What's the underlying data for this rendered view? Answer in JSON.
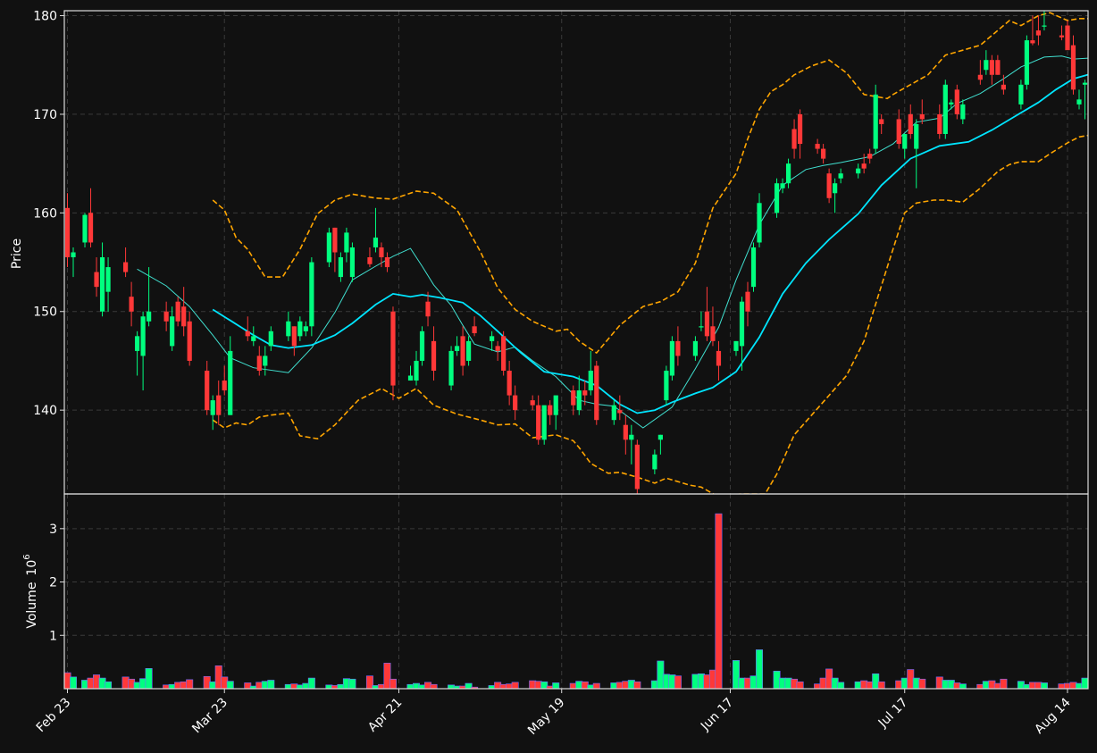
{
  "chart_data": {
    "type": "candlestick",
    "xlabel": "",
    "date_ticks": [
      "Feb 23",
      "Mar 23",
      "Apr 21",
      "May 19",
      "Jun 17",
      "Jul 17",
      "Aug 14"
    ],
    "tick_day_index": [
      0,
      27,
      57,
      85,
      114,
      144,
      172
    ],
    "price_panel": {
      "ylabel": "Price",
      "ylim": [
        131.5,
        180.5
      ],
      "yticks": [
        140,
        150,
        160,
        170,
        180
      ],
      "grid": true
    },
    "volume_panel": {
      "ylabel": "Volume",
      "exponent_label": "10",
      "exponent_power": "6",
      "ylim": [
        0,
        3.65
      ],
      "yticks": [
        1,
        2,
        3
      ],
      "grid": true
    },
    "colors": {
      "up": "#00ff7f",
      "down": "#ff3838",
      "ma_fast": "#40e0d0",
      "ma_slow": "#00e5ff",
      "bands": "#ffa500",
      "background": "#111111"
    },
    "series_style": {
      "ma_fast_width": 1,
      "ma_slow_width": 1.8,
      "band_dash": true
    },
    "days": [
      0,
      1,
      3,
      4,
      5,
      6,
      7,
      10,
      11,
      12,
      13,
      14,
      17,
      18,
      19,
      20,
      21,
      24,
      25,
      26,
      27,
      28,
      31,
      32,
      33,
      34,
      35,
      38,
      39,
      40,
      41,
      42,
      45,
      46,
      47,
      48,
      49,
      52,
      53,
      54,
      55,
      56,
      59,
      60,
      61,
      62,
      63,
      66,
      67,
      68,
      69,
      70,
      73,
      74,
      75,
      76,
      77,
      80,
      81,
      82,
      83,
      84,
      87,
      88,
      89,
      90,
      91,
      94,
      95,
      96,
      97,
      98,
      101,
      102,
      103,
      104,
      105,
      108,
      109,
      110,
      111,
      112,
      115,
      116,
      117,
      118,
      119,
      122,
      123,
      124,
      125,
      126,
      129,
      130,
      131,
      132,
      133,
      136,
      137,
      138,
      139,
      140,
      143,
      144,
      145,
      146,
      147,
      150,
      151,
      152,
      153,
      154,
      157,
      158,
      159,
      160,
      161,
      164,
      165,
      166,
      167,
      168,
      171,
      172,
      173,
      174,
      175
    ],
    "ohlc": [
      [
        160.5,
        162.0,
        154.5,
        155.5
      ],
      [
        155.5,
        156.5,
        153.5,
        156.0
      ],
      [
        157.0,
        160.0,
        156.5,
        159.8
      ],
      [
        160.0,
        162.5,
        156.5,
        157.0
      ],
      [
        154.0,
        155.5,
        151.5,
        152.5
      ],
      [
        150.0,
        157.0,
        149.5,
        155.5
      ],
      [
        152.0,
        155.5,
        150.0,
        154.5
      ],
      [
        155.0,
        156.5,
        153.5,
        154.0
      ],
      [
        151.5,
        153.0,
        148.5,
        150.0
      ],
      [
        146.0,
        148.0,
        143.5,
        147.5
      ],
      [
        145.5,
        150.0,
        142.0,
        149.5
      ],
      [
        149.0,
        154.5,
        148.5,
        150.0
      ],
      [
        150.0,
        151.0,
        148.0,
        149.0
      ],
      [
        146.5,
        150.5,
        146.0,
        149.5
      ],
      [
        151.0,
        151.5,
        148.5,
        149.0
      ],
      [
        150.5,
        152.5,
        147.5,
        148.5
      ],
      [
        149.0,
        150.0,
        144.5,
        145.0
      ],
      [
        144.0,
        145.0,
        139.5,
        140.0
      ],
      [
        139.5,
        141.5,
        138.0,
        141.0
      ],
      [
        141.5,
        143.0,
        138.5,
        139.5
      ],
      [
        143.0,
        144.5,
        141.5,
        142.0
      ],
      [
        139.5,
        147.5,
        139.5,
        146.0
      ],
      [
        148.0,
        149.5,
        147.0,
        147.5
      ],
      [
        147.0,
        148.5,
        146.5,
        147.5
      ],
      [
        145.5,
        146.5,
        143.5,
        144.0
      ],
      [
        144.5,
        146.5,
        143.5,
        145.5
      ],
      [
        146.5,
        148.5,
        146.0,
        148.0
      ],
      [
        147.5,
        150.0,
        147.0,
        149.0
      ],
      [
        148.5,
        148.5,
        145.5,
        146.5
      ],
      [
        147.5,
        149.5,
        147.0,
        149.0
      ],
      [
        148.0,
        149.0,
        147.5,
        148.5
      ],
      [
        148.5,
        155.5,
        147.5,
        155.0
      ],
      [
        155.0,
        158.5,
        154.5,
        158.0
      ],
      [
        158.5,
        158.5,
        154.0,
        156.0
      ],
      [
        153.5,
        156.0,
        153.0,
        155.5
      ],
      [
        156.0,
        158.5,
        155.0,
        158.0
      ],
      [
        153.5,
        157.0,
        153.0,
        156.5
      ],
      [
        155.5,
        156.5,
        154.5,
        154.8
      ],
      [
        156.5,
        160.5,
        156.0,
        157.5
      ],
      [
        156.5,
        157.0,
        154.5,
        155.5
      ],
      [
        155.5,
        156.0,
        154.0,
        154.5
      ],
      [
        150.0,
        150.5,
        141.0,
        142.5
      ],
      [
        143.0,
        144.5,
        143.0,
        143.5
      ],
      [
        143.0,
        146.0,
        142.5,
        145.0
      ],
      [
        145.0,
        148.5,
        144.5,
        148.0
      ],
      [
        151.0,
        152.0,
        148.5,
        149.5
      ],
      [
        147.0,
        148.5,
        143.0,
        144.0
      ],
      [
        142.5,
        146.5,
        142.0,
        146.0
      ],
      [
        146.0,
        147.5,
        145.5,
        146.5
      ],
      [
        147.5,
        148.5,
        143.5,
        144.5
      ],
      [
        145.0,
        147.5,
        144.5,
        147.0
      ],
      [
        148.5,
        149.5,
        147.5,
        147.8
      ],
      [
        147.0,
        148.0,
        146.0,
        147.5
      ],
      [
        146.5,
        147.0,
        145.0,
        146.0
      ],
      [
        147.5,
        148.0,
        143.5,
        144.0
      ],
      [
        144.0,
        145.0,
        140.5,
        141.5
      ],
      [
        141.5,
        142.5,
        139.0,
        140.0
      ],
      [
        141.0,
        141.5,
        140.0,
        140.5
      ],
      [
        140.5,
        141.5,
        136.5,
        137.0
      ],
      [
        137.0,
        140.0,
        136.5,
        140.5
      ],
      [
        140.5,
        141.0,
        138.5,
        139.5
      ],
      [
        139.5,
        140.5,
        138.0,
        141.5
      ],
      [
        142.0,
        142.5,
        139.5,
        140.5
      ],
      [
        140.0,
        143.5,
        139.5,
        142.0
      ],
      [
        142.0,
        143.0,
        140.5,
        141.5
      ],
      [
        142.0,
        146.0,
        141.5,
        144.0
      ],
      [
        144.5,
        145.0,
        138.5,
        139.0
      ],
      [
        139.0,
        141.0,
        138.5,
        140.5
      ],
      [
        140.0,
        141.5,
        139.0,
        139.7
      ],
      [
        138.5,
        139.5,
        135.5,
        137.0
      ],
      [
        137.0,
        138.5,
        134.5,
        137.5
      ],
      [
        136.5,
        137.0,
        131.0,
        132.0
      ],
      [
        134.0,
        136.0,
        133.5,
        135.5
      ],
      [
        137.0,
        137.5,
        135.5,
        137.5
      ],
      [
        141.0,
        144.5,
        140.5,
        144.0
      ],
      [
        143.5,
        147.5,
        143.0,
        147.0
      ],
      [
        147.0,
        148.5,
        144.5,
        145.5
      ],
      [
        145.5,
        147.5,
        145.0,
        147.0
      ],
      [
        148.5,
        150.0,
        148.0,
        148.5
      ],
      [
        150.0,
        152.5,
        147.0,
        147.5
      ],
      [
        148.5,
        150.5,
        146.5,
        147.0
      ],
      [
        146.0,
        147.0,
        143.0,
        144.5
      ],
      [
        146.0,
        147.0,
        145.5,
        147.0
      ],
      [
        146.5,
        151.5,
        144.0,
        151.0
      ],
      [
        152.0,
        153.0,
        148.5,
        150.0
      ],
      [
        152.5,
        157.0,
        152.0,
        156.5
      ],
      [
        157.0,
        162.0,
        156.5,
        161.0
      ],
      [
        160.0,
        163.5,
        159.5,
        163.0
      ],
      [
        162.5,
        163.5,
        162.0,
        163.0
      ],
      [
        163.0,
        165.5,
        162.5,
        165.0
      ],
      [
        168.5,
        169.5,
        165.5,
        166.5
      ],
      [
        170.0,
        170.5,
        165.5,
        167.0
      ],
      [
        167.0,
        167.5,
        166.0,
        166.5
      ],
      [
        166.5,
        167.0,
        165.0,
        165.5
      ],
      [
        164.0,
        164.5,
        161.0,
        161.5
      ],
      [
        162.0,
        163.5,
        160.0,
        163.0
      ],
      [
        163.5,
        164.5,
        163.0,
        164.0
      ],
      [
        164.0,
        165.0,
        163.5,
        164.5
      ],
      [
        165.0,
        166.0,
        164.0,
        164.5
      ],
      [
        166.0,
        166.5,
        165.0,
        165.5
      ],
      [
        166.5,
        173.0,
        166.0,
        172.0
      ],
      [
        169.5,
        170.0,
        168.0,
        169.0
      ],
      [
        169.5,
        170.5,
        166.5,
        167.0
      ],
      [
        166.5,
        168.0,
        165.5,
        168.0
      ],
      [
        170.0,
        171.0,
        167.5,
        168.0
      ],
      [
        166.5,
        169.5,
        162.5,
        169.0
      ],
      [
        170.0,
        171.5,
        169.0,
        169.5
      ],
      [
        170.0,
        171.0,
        167.5,
        168.0
      ],
      [
        168.0,
        173.5,
        167.5,
        173.0
      ],
      [
        171.0,
        171.5,
        170.5,
        171.2
      ],
      [
        172.5,
        173.0,
        169.5,
        170.0
      ],
      [
        169.5,
        171.5,
        169.0,
        171.0
      ],
      [
        174.0,
        175.5,
        173.0,
        173.5
      ],
      [
        174.5,
        176.5,
        174.0,
        175.5
      ],
      [
        175.5,
        176.0,
        173.0,
        174.0
      ],
      [
        175.5,
        176.0,
        174.0,
        174.0
      ],
      [
        173.0,
        174.0,
        172.0,
        172.5
      ],
      [
        171.0,
        173.5,
        170.5,
        173.0
      ],
      [
        173.0,
        178.0,
        172.5,
        177.5
      ],
      [
        177.5,
        180.0,
        177.0,
        177.2
      ],
      [
        178.5,
        180.0,
        177.0,
        178.0
      ],
      [
        179.0,
        180.5,
        178.5,
        179.0
      ],
      [
        178.0,
        179.0,
        177.5,
        177.8
      ],
      [
        179.0,
        179.5,
        177.5,
        176.5
      ],
      [
        177.0,
        178.0,
        172.0,
        172.5
      ],
      [
        171.0,
        172.5,
        170.5,
        171.5
      ],
      [
        173.0,
        173.5,
        169.5,
        173.2
      ]
    ],
    "volume": [
      0.3,
      0.22,
      0.16,
      0.2,
      0.26,
      0.2,
      0.13,
      0.22,
      0.18,
      0.12,
      0.19,
      0.38,
      0.07,
      0.08,
      0.12,
      0.13,
      0.17,
      0.23,
      0.13,
      0.43,
      0.22,
      0.14,
      0.11,
      0.05,
      0.12,
      0.14,
      0.16,
      0.08,
      0.09,
      0.07,
      0.1,
      0.2,
      0.07,
      0.06,
      0.08,
      0.19,
      0.18,
      0.24,
      0.06,
      0.08,
      0.48,
      0.18,
      0.08,
      0.1,
      0.07,
      0.12,
      0.08,
      0.07,
      0.05,
      0.05,
      0.1,
      0.03,
      0.06,
      0.12,
      0.08,
      0.09,
      0.12,
      0.15,
      0.14,
      0.13,
      0.05,
      0.11,
      0.1,
      0.14,
      0.13,
      0.07,
      0.1,
      0.11,
      0.12,
      0.14,
      0.16,
      0.13,
      0.15,
      0.52,
      0.27,
      0.26,
      0.24,
      0.27,
      0.28,
      0.26,
      0.35,
      3.28,
      0.53,
      0.2,
      0.2,
      0.24,
      0.73,
      0.33,
      0.2,
      0.2,
      0.18,
      0.13,
      0.09,
      0.2,
      0.37,
      0.2,
      0.12,
      0.13,
      0.15,
      0.13,
      0.28,
      0.13,
      0.15,
      0.2,
      0.36,
      0.2,
      0.18,
      0.22,
      0.16,
      0.16,
      0.11,
      0.09,
      0.08,
      0.14,
      0.15,
      0.1,
      0.18,
      0.14,
      0.08,
      0.12,
      0.12,
      0.11,
      0.09,
      0.1,
      0.12,
      0.1,
      0.2,
      0.1
    ],
    "ma_fast_days": [
      12,
      17,
      21,
      25,
      28,
      32,
      38,
      42,
      46,
      49,
      53,
      56,
      59,
      61,
      63,
      66,
      68,
      70,
      74,
      77,
      80,
      84,
      88,
      91,
      94,
      99,
      104,
      108,
      112,
      115,
      119,
      123,
      127,
      130,
      133,
      138,
      142,
      146,
      150,
      153,
      157,
      161,
      164,
      168,
      171,
      173,
      176
    ],
    "ma_fast": [
      154.3,
      152.6,
      150.5,
      147.6,
      145.3,
      144.3,
      143.8,
      146.3,
      149.9,
      153.2,
      154.6,
      155.6,
      156.4,
      154.6,
      152.7,
      150.6,
      148.6,
      146.7,
      145.9,
      146.4,
      145.0,
      143.4,
      141.0,
      140.6,
      140.4,
      138.2,
      140.3,
      144.2,
      148.4,
      153.2,
      158.8,
      162.8,
      164.4,
      164.8,
      165.1,
      165.7,
      167.0,
      169.2,
      169.6,
      171.1,
      172.1,
      173.6,
      174.8,
      175.8,
      175.9,
      175.6,
      175.7
    ],
    "ma_slow_days": [
      25,
      28,
      32,
      35,
      38,
      42,
      46,
      49,
      53,
      56,
      59,
      61,
      64,
      68,
      71,
      74,
      78,
      82,
      87,
      91,
      95,
      98,
      101,
      104,
      108,
      111,
      115,
      119,
      123,
      127,
      131,
      136,
      140,
      145,
      150,
      155,
      159,
      163,
      167,
      170,
      173,
      176
    ],
    "ma_slow": [
      150.2,
      149.1,
      147.6,
      146.6,
      146.3,
      146.6,
      147.6,
      148.8,
      150.7,
      151.8,
      151.5,
      151.7,
      151.4,
      150.9,
      149.6,
      148.0,
      145.8,
      143.9,
      143.4,
      142.5,
      140.6,
      139.7,
      140.0,
      140.8,
      141.7,
      142.3,
      143.9,
      147.4,
      151.8,
      154.9,
      157.3,
      159.9,
      162.8,
      165.5,
      166.8,
      167.2,
      168.4,
      169.8,
      171.2,
      172.5,
      173.6,
      174.1
    ],
    "upper_band_days": [
      25,
      27,
      29,
      31,
      34,
      37,
      40,
      43,
      46,
      49,
      53,
      56,
      60,
      63,
      67,
      71,
      74,
      77,
      80,
      84,
      86,
      88,
      91,
      95,
      99,
      102,
      105,
      108,
      111,
      115,
      117,
      119,
      121,
      123,
      125,
      128,
      131,
      134,
      137,
      141,
      142,
      145,
      148,
      151,
      154,
      157,
      160,
      162,
      164,
      167,
      169,
      172,
      174,
      176
    ],
    "upper_band": [
      161.3,
      160.3,
      157.5,
      156.3,
      153.5,
      153.5,
      156.3,
      159.9,
      161.3,
      161.9,
      161.5,
      161.4,
      162.2,
      162.0,
      160.3,
      156.1,
      152.4,
      150.2,
      149.0,
      148.0,
      148.2,
      147.0,
      145.8,
      148.6,
      150.5,
      151.0,
      152.0,
      154.9,
      160.5,
      164.0,
      167.5,
      170.5,
      172.3,
      173.0,
      174.0,
      174.9,
      175.5,
      174.2,
      172.0,
      171.6,
      172.0,
      173.0,
      174.0,
      176.0,
      176.5,
      177.0,
      178.5,
      179.5,
      179.0,
      180.0,
      180.3,
      179.5,
      179.7,
      179.7
    ],
    "lower_band_days": [
      25,
      27,
      29,
      31,
      33,
      35,
      38,
      40,
      43,
      46,
      50,
      54,
      57,
      60,
      63,
      67,
      71,
      74,
      77,
      80,
      84,
      87,
      88,
      90,
      93,
      95,
      98,
      101,
      103,
      107,
      109,
      112,
      114,
      116,
      118,
      120,
      122,
      125,
      128,
      131,
      134,
      137,
      141,
      144,
      146,
      149,
      151,
      154,
      157,
      160,
      162,
      164,
      167,
      169,
      172,
      174,
      176
    ],
    "lower_band": [
      139.0,
      138.2,
      138.7,
      138.5,
      139.3,
      139.5,
      139.7,
      137.4,
      137.1,
      138.5,
      141.0,
      142.2,
      141.2,
      142.2,
      140.5,
      139.6,
      139.0,
      138.5,
      138.6,
      137.2,
      137.5,
      136.9,
      136.2,
      134.6,
      133.6,
      133.7,
      133.2,
      132.6,
      133.1,
      132.4,
      132.2,
      131.2,
      131.4,
      131.5,
      131.5,
      131.5,
      133.5,
      137.5,
      139.5,
      141.5,
      143.5,
      147.0,
      154.5,
      160.0,
      161.0,
      161.3,
      161.3,
      161.1,
      162.5,
      164.2,
      164.9,
      165.2,
      165.2,
      166.0,
      167.1,
      167.7,
      167.9
    ]
  }
}
